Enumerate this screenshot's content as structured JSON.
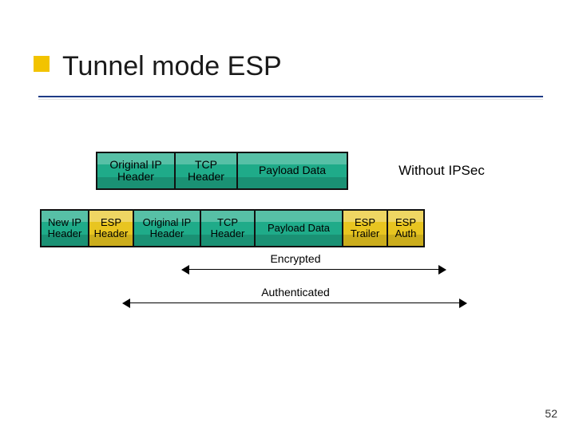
{
  "slide": {
    "title": "Tunnel mode ESP",
    "number": "52"
  },
  "row1": {
    "original_ip": "Original IP Header",
    "tcp": "TCP Header",
    "payload": "Payload Data",
    "label": "Without IPSec"
  },
  "row2": {
    "new_ip": "New IP Header",
    "esp_header": "ESP Header",
    "original_ip": "Original IP Header",
    "tcp": "TCP Header",
    "payload": "Payload Data",
    "esp_trailer": "ESP Trailer",
    "esp_auth": "ESP Auth"
  },
  "ranges": {
    "encrypted": "Encrypted",
    "authenticated": "Authenticated"
  }
}
